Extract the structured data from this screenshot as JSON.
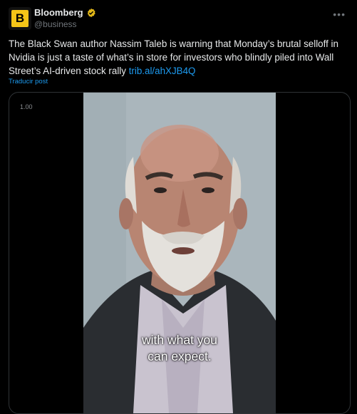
{
  "account": {
    "display_name": "Bloomberg",
    "handle": "@business",
    "avatar_letter": "B",
    "verified_color": "#e2b719"
  },
  "tweet": {
    "text": "The Black Swan author Nassim Taleb is warning that Monday’s brutal selloff in Nvidia is just a taste of what’s in store for investors who blindly piled into Wall Street’s AI-driven stock rally ",
    "link": "trib.al/ahXJB4Q",
    "translate_label": "Traducir post"
  },
  "media": {
    "speed": "1.00",
    "subtitle_line1": "with what you",
    "subtitle_line2": "can expect."
  },
  "colors": {
    "background": "#000000",
    "text": "#e7e9ea",
    "secondary": "#71767b",
    "link": "#1d9bf0"
  },
  "icons": {
    "more": "ellipsis-icon",
    "verified": "verified-badge-icon"
  }
}
